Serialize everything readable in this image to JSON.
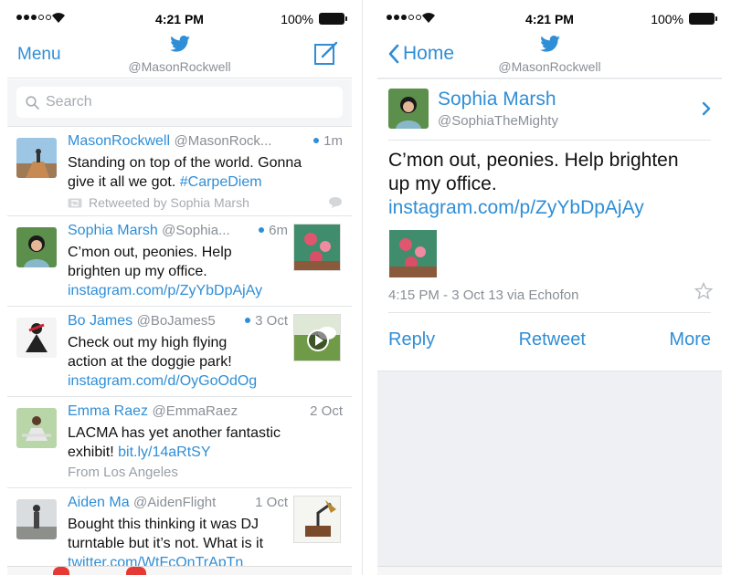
{
  "left": {
    "status": {
      "time": "4:21 PM",
      "battery": "100%"
    },
    "nav": {
      "menu_label": "Menu",
      "handle": "@MasonRockwell"
    },
    "search": {
      "placeholder": "Search"
    },
    "tweets": [
      {
        "name": "MasonRockwell",
        "handle": "@MasonRock...",
        "time": "1m",
        "unread": true,
        "line1": "Standing on top of the world. Gonna",
        "line2": "give it all we got. ",
        "hashtag": "#CarpeDiem",
        "retweeted_by": "Retweeted by Sophia Marsh"
      },
      {
        "name": "Sophia Marsh",
        "handle": "@Sophia...",
        "time": "6m",
        "unread": true,
        "line1": "C’mon out, peonies. Help",
        "line2": "brighten up my office.",
        "link": "instagram.com/p/ZyYbDpAjAy"
      },
      {
        "name": "Bo James",
        "handle": "@BoJames5",
        "time": "3 Oct",
        "unread": true,
        "line1": "Check out my high flying",
        "line2": "action at the doggie park!",
        "link": "instagram.com/d/OyGoOdOg"
      },
      {
        "name": "Emma Raez",
        "handle": "@EmmaRaez",
        "time": "2 Oct",
        "unread": false,
        "line1": "LACMA has yet another fantastic",
        "line2": "exhibit! ",
        "link": "bit.ly/14aRtSY",
        "location": "From Los Angeles"
      },
      {
        "name": "Aiden Ma",
        "handle": "@AidenFlight",
        "time": "1 Oct",
        "unread": false,
        "line1": "Bought this thinking it was DJ",
        "line2": "turntable but it’s not. What is it",
        "link": "twitter.com/WtFcOnTrApTn"
      }
    ]
  },
  "right": {
    "status": {
      "time": "4:21 PM",
      "battery": "100%"
    },
    "nav": {
      "back_label": "Home",
      "handle": "@MasonRockwell"
    },
    "detail": {
      "name": "Sophia Marsh",
      "handle": "@SophiaTheMighty",
      "text_line1": "C’mon out, peonies. Help brighten",
      "text_line2": "up my office.",
      "link": "instagram.com/p/ZyYbDpAjAy",
      "meta": "4:15 PM - 3 Oct 13 via Echofon",
      "actions": {
        "reply": "Reply",
        "retweet": "Retweet",
        "more": "More"
      }
    }
  },
  "colors": {
    "accent": "#2f8ed6",
    "secondary_text": "#8a8f96",
    "badge": "#e53935"
  },
  "icons": [
    "twitter-bird-icon",
    "compose-icon",
    "search-icon",
    "retweet-icon",
    "reply-bubble-icon",
    "back-chevron-icon",
    "chevron-right-icon",
    "star-icon",
    "wifi-icon",
    "battery-icon",
    "play-icon"
  ]
}
